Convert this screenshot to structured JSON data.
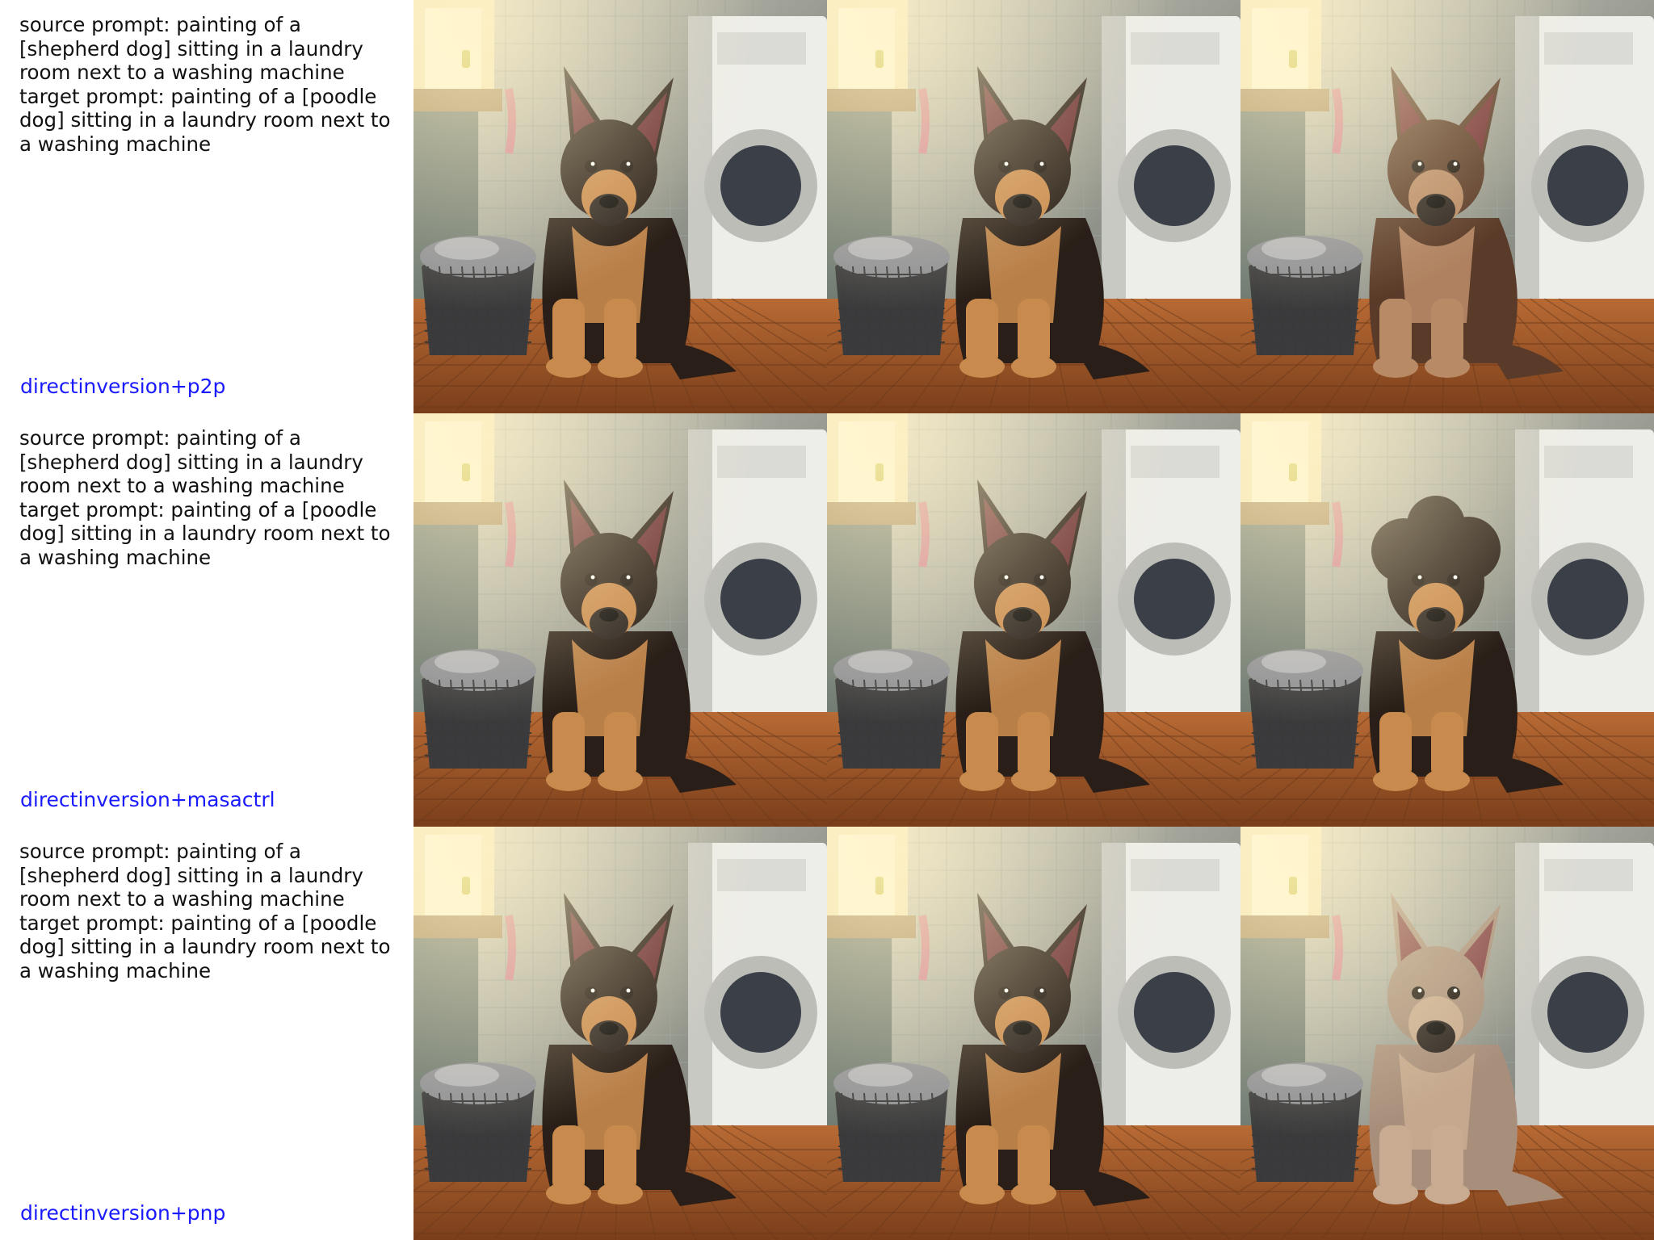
{
  "rows": [
    {
      "prompt_lines": [
        "source prompt: painting of a",
        "[shepherd dog] sitting in a laundry",
        "room next to a washing machine",
        "target prompt: painting of a [poodle",
        "dog] sitting in a laundry room next to",
        "a washing machine"
      ],
      "method": "directinversion+p2p"
    },
    {
      "prompt_lines": [
        "source prompt: painting of a",
        "[shepherd dog] sitting in a laundry",
        "room next to a washing machine",
        "target prompt: painting of a [poodle",
        "dog] sitting in a laundry room next to",
        "a washing machine"
      ],
      "method": "directinversion+masactrl"
    },
    {
      "prompt_lines": [
        "source prompt: painting of a",
        "[shepherd dog] sitting in a laundry",
        "room next to a washing machine",
        "target prompt: painting of a [poodle",
        "dog] sitting in a laundry room next to",
        "a washing machine"
      ],
      "method": "directinversion+pnp"
    }
  ],
  "images": {
    "source": {
      "dog_coat": "#2a1f18",
      "dog_tan": "#c98a4e",
      "ear_style": "pointed"
    },
    "edits": [
      {
        "dog_coat": "#5a3a28",
        "dog_tan": "#b88a66",
        "ear_style": "pointed"
      },
      {
        "dog_coat": "#2a1f18",
        "dog_tan": "#c98a4e",
        "ear_style": "curly"
      },
      {
        "dog_coat": "#a88f7c",
        "dog_tan": "#c8ab90",
        "ear_style": "pointed"
      }
    ]
  },
  "colors": {
    "caption_text": "#111111",
    "method_label": "#1a1aff"
  }
}
